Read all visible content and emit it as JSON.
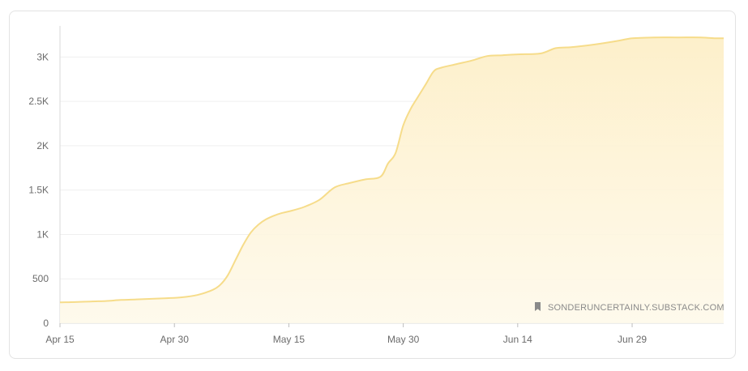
{
  "chart_data": {
    "type": "area",
    "x": [
      "Apr 15",
      "Apr 17",
      "Apr 19",
      "Apr 21",
      "Apr 23",
      "Apr 25",
      "Apr 27",
      "Apr 29",
      "May 1",
      "May 3",
      "May 5",
      "May 6",
      "May 7",
      "May 8",
      "May 9",
      "May 10",
      "May 11",
      "May 12",
      "May 13",
      "May 14",
      "May 15",
      "May 17",
      "May 19",
      "May 21",
      "May 23",
      "May 25",
      "May 27",
      "May 28",
      "May 29",
      "May 30",
      "May 31",
      "Jun 1",
      "Jun 2",
      "Jun 3",
      "Jun 4",
      "Jun 6",
      "Jun 8",
      "Jun 10",
      "Jun 12",
      "Jun 14",
      "Jun 17",
      "Jun 19",
      "Jun 21",
      "Jun 24",
      "Jun 27",
      "Jun 29",
      "Jul 2",
      "Jul 5",
      "Jul 8",
      "Jul 10"
    ],
    "series": [
      {
        "values": [
          235,
          238,
          245,
          250,
          262,
          268,
          275,
          282,
          292,
          318,
          375,
          432,
          540,
          710,
          880,
          1020,
          1110,
          1170,
          1210,
          1240,
          1260,
          1310,
          1390,
          1530,
          1580,
          1620,
          1650,
          1800,
          1920,
          2230,
          2420,
          2560,
          2700,
          2840,
          2880,
          2920,
          2960,
          3010,
          3020,
          3030,
          3040,
          3100,
          3110,
          3140,
          3180,
          3210,
          3220,
          3220,
          3220,
          3210
        ],
        "color": "#f6dc8a",
        "fill": "#fdf3d4"
      }
    ],
    "x_ticks": [
      "Apr 15",
      "Apr 30",
      "May 15",
      "May 30",
      "Jun 14",
      "Jun 29"
    ],
    "y_ticks": [
      0,
      500,
      1000,
      1500,
      2000,
      2500,
      3000
    ],
    "y_tick_labels": [
      "0",
      "500",
      "1K",
      "1.5K",
      "2K",
      "2.5K",
      "3K"
    ],
    "ylim": [
      0,
      3350
    ],
    "grid": true
  },
  "watermark": {
    "text": "SONDERUNCERTAINLY.SUBSTACK.COM",
    "icon": "bookmark-icon"
  }
}
